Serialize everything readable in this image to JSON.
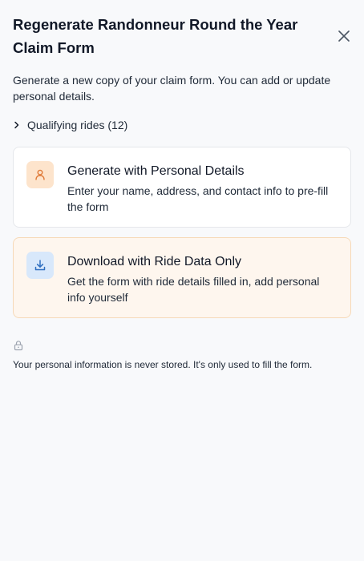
{
  "dialog": {
    "title": "Regenerate Randonneur Round the Year Claim Form",
    "description": "Generate a new copy of your claim form. You can add or update personal details.",
    "close_icon": "close-icon"
  },
  "qualifying_rides": {
    "label": "Qualifying rides (12)",
    "icon": "chevron-right-icon"
  },
  "options": [
    {
      "title": "Generate with Personal Details",
      "subtitle": "Enter your name, address, and contact info to pre-fill the form",
      "icon": "user-icon",
      "accent": "#e07b39"
    },
    {
      "title": "Download with Ride Data Only",
      "subtitle": "Get the form with ride details filled in, add personal info yourself",
      "icon": "download-icon",
      "accent": "#2f6fc0"
    }
  ],
  "privacy": {
    "icon": "lock-icon",
    "note": "Your personal information is never stored. It's only used to fill the form."
  },
  "colors": {
    "background": "#f8f9fb",
    "card_highlight": "#fef6ee"
  }
}
